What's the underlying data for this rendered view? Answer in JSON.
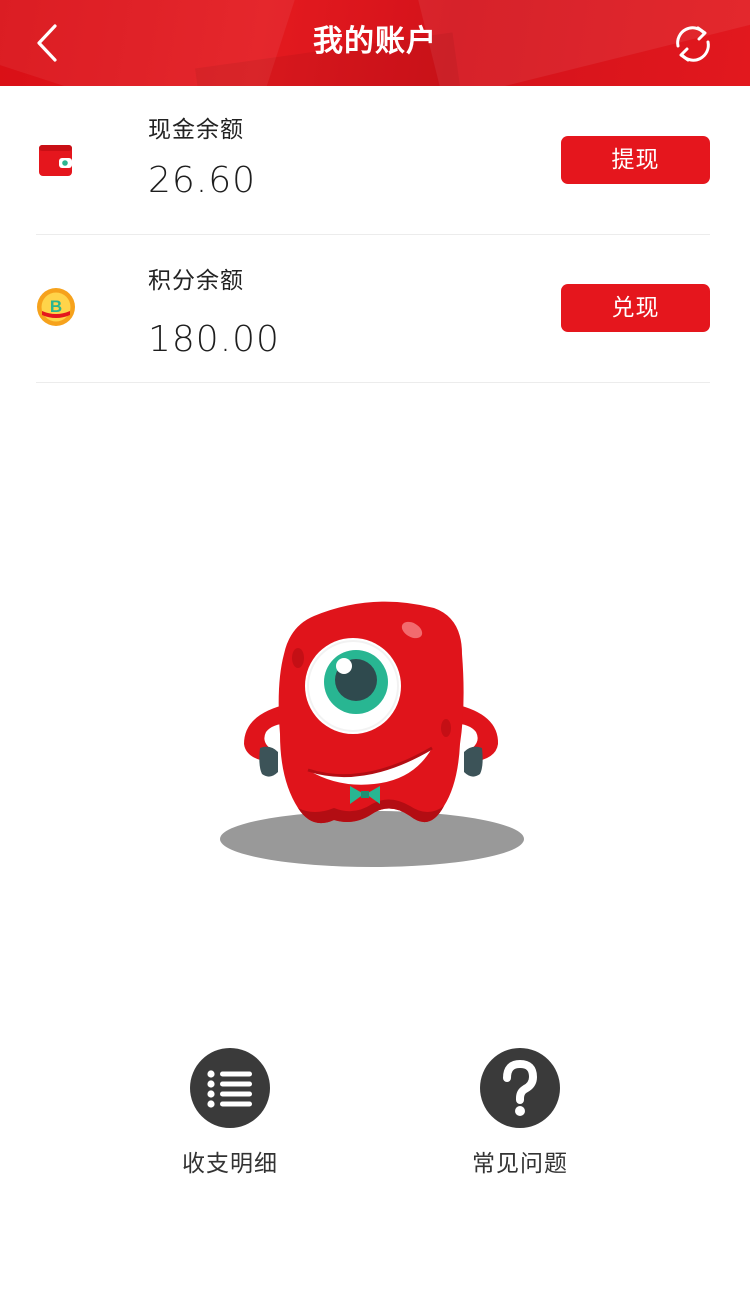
{
  "header": {
    "title": "我的账户",
    "back_icon": "chevron-left-icon",
    "refresh_icon": "refresh-icon",
    "background_color": "#e0141b"
  },
  "accounts": [
    {
      "icon": "wallet-icon",
      "label": "现金余额",
      "amount": "26.60",
      "action_label": "提现"
    },
    {
      "icon": "points-coin-icon",
      "label": "积分余额",
      "amount": "180.00",
      "action_label": "兑现"
    }
  ],
  "mascot": {
    "icon": "red-one-eyed-monster-mascot"
  },
  "bottom_actions": [
    {
      "icon": "list-icon",
      "label": "收支明细"
    },
    {
      "icon": "question-mark-icon",
      "label": "常见问题"
    }
  ],
  "colors": {
    "accent": "#e5161d",
    "icon_circle": "#3a3a3a",
    "divider": "#ececec"
  }
}
